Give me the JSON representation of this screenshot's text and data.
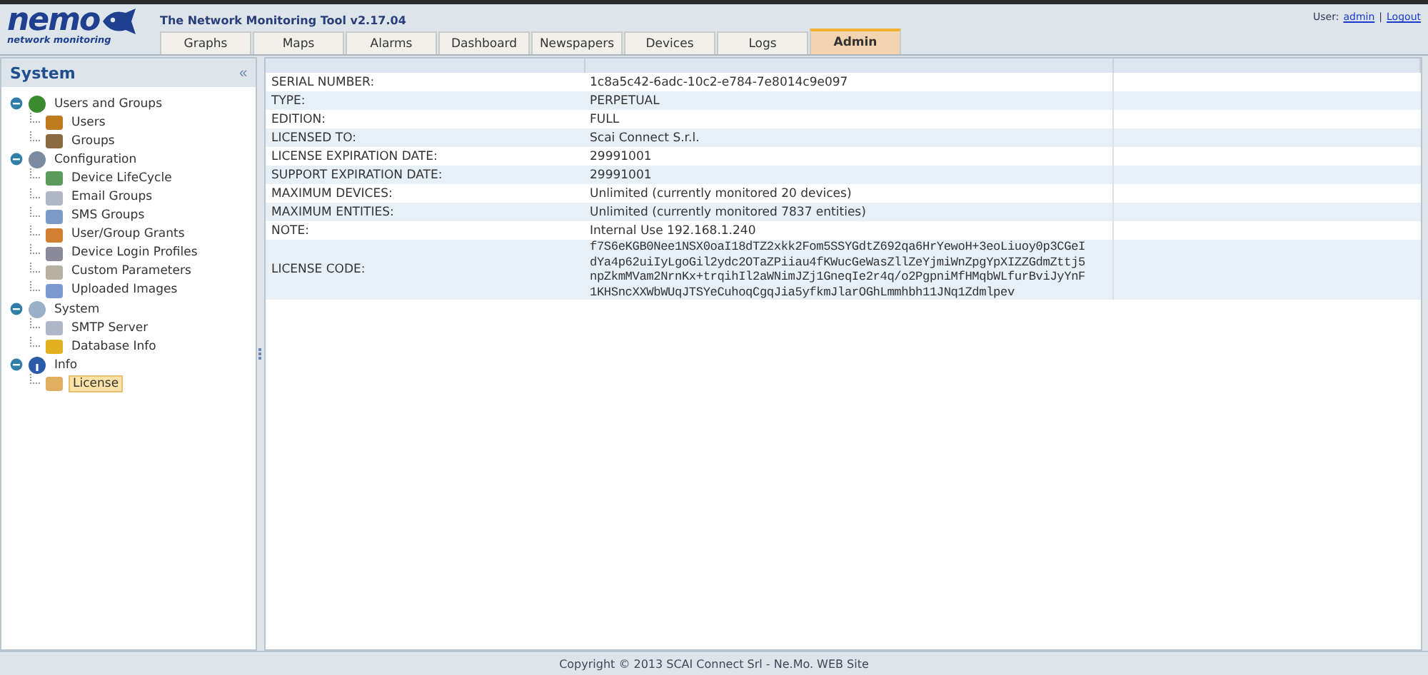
{
  "header": {
    "logo": "nemo",
    "logo_sub": "network monitoring",
    "title": "The Network Monitoring Tool v2.17.04",
    "user_label": "User:",
    "user": "admin",
    "separator": "|",
    "logout": "Logout"
  },
  "tabs": [
    {
      "label": "Graphs",
      "selected": false
    },
    {
      "label": "Maps",
      "selected": false
    },
    {
      "label": "Alarms",
      "selected": false
    },
    {
      "label": "Dashboard",
      "selected": false
    },
    {
      "label": "Newspapers",
      "selected": false
    },
    {
      "label": "Devices",
      "selected": false
    },
    {
      "label": "Logs",
      "selected": false
    },
    {
      "label": "Admin",
      "selected": true
    }
  ],
  "sidebar": {
    "title": "System",
    "collapse": "«",
    "tree": [
      {
        "label": "Users and Groups",
        "expanded": true,
        "kind": "people",
        "children": [
          {
            "label": "Users",
            "kind": "user",
            "selected": false
          },
          {
            "label": "Groups",
            "kind": "group",
            "selected": false
          }
        ]
      },
      {
        "label": "Configuration",
        "expanded": true,
        "kind": "config",
        "children": [
          {
            "label": "Device LifeCycle",
            "kind": "monitor",
            "selected": false
          },
          {
            "label": "Email Groups",
            "kind": "mail",
            "selected": false
          },
          {
            "label": "SMS Groups",
            "kind": "phone",
            "selected": false
          },
          {
            "label": "User/Group Grants",
            "kind": "grant",
            "selected": false
          },
          {
            "label": "Device Login Profiles",
            "kind": "key",
            "selected": false
          },
          {
            "label": "Custom Parameters",
            "kind": "gear",
            "selected": false
          },
          {
            "label": "Uploaded Images",
            "kind": "image",
            "selected": false
          }
        ]
      },
      {
        "label": "System",
        "expanded": true,
        "kind": "search",
        "children": [
          {
            "label": "SMTP Server",
            "kind": "mail",
            "selected": false
          },
          {
            "label": "Database Info",
            "kind": "database",
            "selected": false
          }
        ]
      },
      {
        "label": "Info",
        "expanded": true,
        "kind": "info",
        "children": [
          {
            "label": "License",
            "kind": "folder",
            "selected": true
          }
        ]
      }
    ]
  },
  "table": {
    "rows": [
      {
        "label": "SERIAL NUMBER:",
        "value": [
          "1c8a5c42-6adc-10c2-e784-7e8014c9e097"
        ]
      },
      {
        "label": "TYPE:",
        "value": [
          "PERPETUAL"
        ]
      },
      {
        "label": "EDITION:",
        "value": [
          "FULL"
        ]
      },
      {
        "label": "LICENSED TO:",
        "value": [
          "Scai Connect S.r.l."
        ]
      },
      {
        "label": "LICENSE EXPIRATION DATE:",
        "value": [
          "29991001"
        ]
      },
      {
        "label": "SUPPORT EXPIRATION DATE:",
        "value": [
          "29991001"
        ]
      },
      {
        "label": "MAXIMUM DEVICES:",
        "value": [
          "Unlimited (currently monitored 20 devices)"
        ]
      },
      {
        "label": "MAXIMUM ENTITIES:",
        "value": [
          "Unlimited (currently monitored 7837 entities)"
        ]
      },
      {
        "label": "NOTE:",
        "value": [
          "Internal Use 192.168.1.240"
        ]
      },
      {
        "label": "LICENSE CODE:",
        "kind": "code",
        "value": [
          "f7S6eKGB0Nee1NSX0oaI18dTZ2xkk2Fom5SSYGdtZ692qa6HrYewoH+3eoLiuoy0p3CGeI",
          "dYa4p62uiIyLgoGil2ydc2OTaZPiiau4fKWucGeWasZllZeYjmiWnZpgYpXIZZGdmZttj5",
          "npZkmMVam2NrnKx+trqihIl2aWNimJZj1GneqIe2r4q/o2PgpniMfHMqbWLfurBviJyYnF",
          "1KHSncXXWbWUqJTSYeCuhoqCgqJia5yfkmJlarOGhLmmhbh11JNq1Zdmlpev"
        ]
      }
    ]
  },
  "footer": "Copyright © 2013 SCAI Connect Srl - Ne.Mo. WEB Site"
}
